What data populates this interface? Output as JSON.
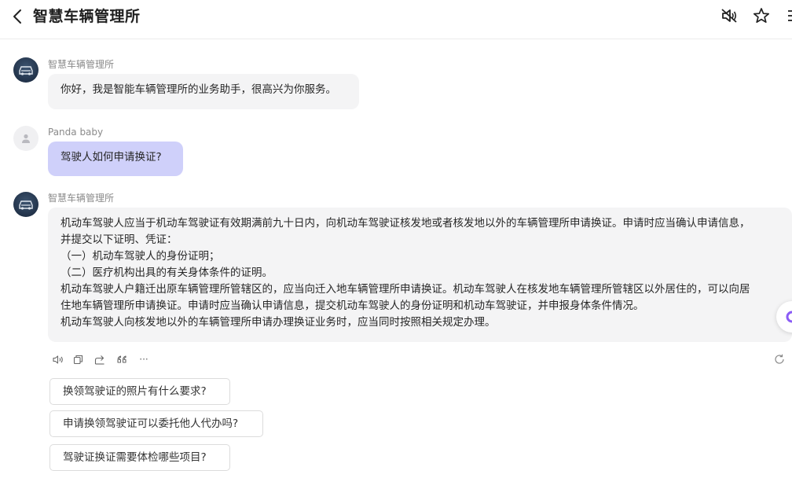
{
  "header": {
    "title": "智慧车辆管理所",
    "icons": [
      "back-arrow-icon",
      "speaker-mute-icon",
      "star-icon",
      "menu-icon"
    ]
  },
  "messages": [
    {
      "role": "bot",
      "sender": "智慧车辆管理所",
      "text": "你好，我是智能车辆管理所的业务助手，很高兴为你服务。"
    },
    {
      "role": "user",
      "sender": "Panda baby",
      "text": "驾驶人如何申请换证?"
    },
    {
      "role": "bot",
      "sender": "智慧车辆管理所",
      "lines": [
        "机动车驾驶人应当于机动车驾驶证有效期满前九十日内，向机动车驾驶证核发地或者核发地以外的车辆管理所申请换证。申请时应当确认申请信息，",
        "并提交以下证明、凭证：",
        "（一）机动车驾驶人的身份证明；",
        "（二）医疗机构出具的有关身体条件的证明。",
        "机动车驾驶人户籍迁出原车辆管理所管辖区的，应当向迁入地车辆管理所申请换证。机动车驾驶人在核发地车辆管理所管辖区以外居住的，可以向居",
        "住地车辆管理所申请换证。申请时应当确认申请信息，提交机动车驾驶人的身份证明和机动车驾驶证，并申报身体条件情况。",
        "机动车驾驶人向核发地以外的车辆管理所申请办理换证业务时，应当同时按照相关规定办理。"
      ]
    }
  ],
  "actions": {
    "icons": [
      "speaker-icon",
      "copy-icon",
      "share-icon",
      "quote-icon",
      "more-icon",
      "refresh-icon"
    ],
    "more_label": "···"
  },
  "suggestions": [
    "换领驾驶证的照片有什么要求?",
    "申请换领驾驶证可以委托他人代办吗?",
    "驾驶证换证需要体检哪些项目?"
  ],
  "colors": {
    "user_bubble": "#cfd0fa",
    "bot_bubble": "#f4f4f5",
    "accent": "#8b5cf6"
  }
}
